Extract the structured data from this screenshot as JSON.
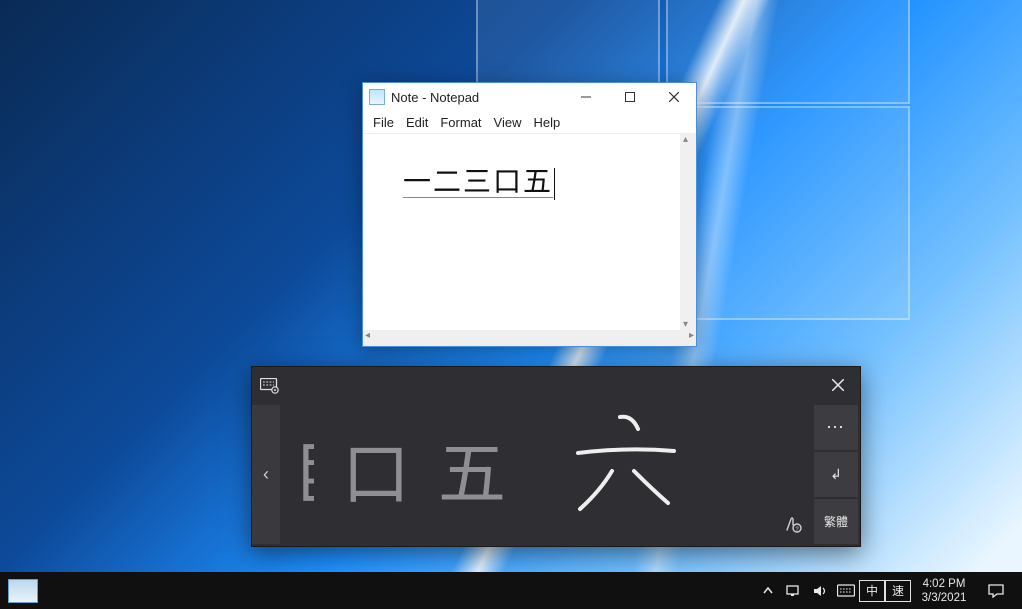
{
  "os": {
    "platform": "Windows 10"
  },
  "notepad": {
    "title": "Note - Notepad",
    "menu": {
      "file": "File",
      "edit": "Edit",
      "format": "Format",
      "view": "View",
      "help": "Help"
    },
    "content": "一二三口五",
    "ime_underlined": true
  },
  "ime_panel": {
    "canvas_chars": [
      "巨",
      "口",
      "五",
      "六"
    ],
    "first_char_partial": true,
    "right_buttons": {
      "more": "⋯",
      "enter": "↲",
      "mode": "繁體"
    }
  },
  "taskbar": {
    "tray": {
      "ime_lang": "中",
      "ime_mode": "速"
    },
    "clock": {
      "time": "4:02 PM",
      "date": "3/3/2021"
    }
  }
}
